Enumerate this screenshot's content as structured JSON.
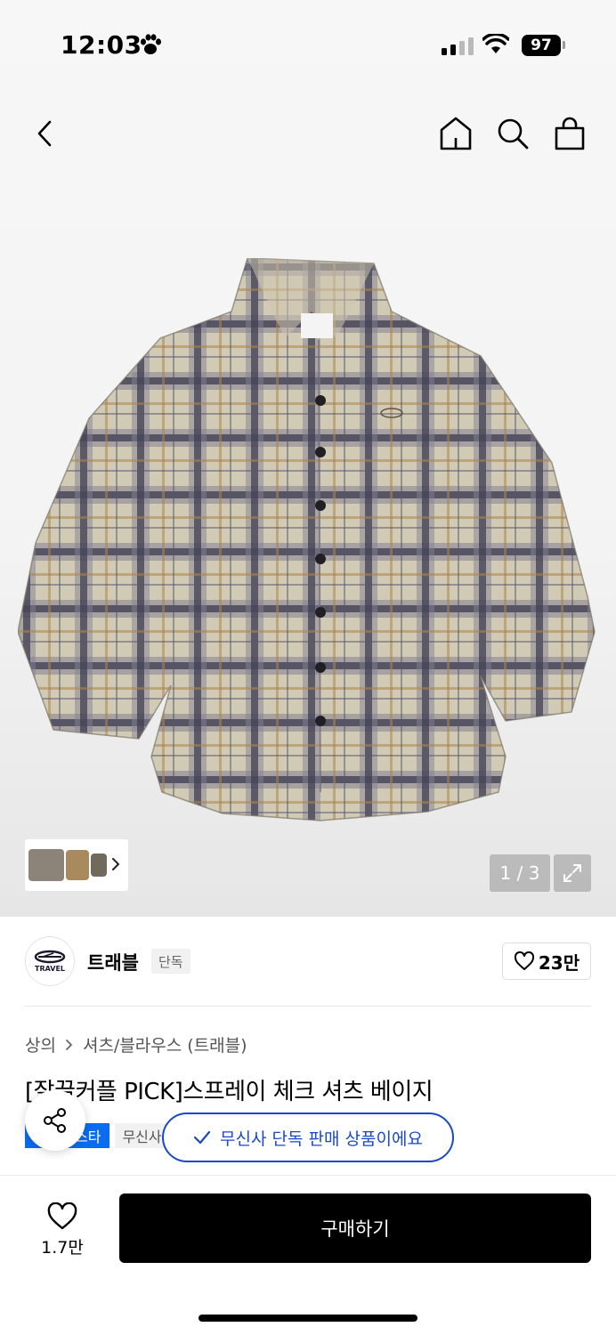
{
  "status_bar": {
    "time": "12:03",
    "battery": "97"
  },
  "gallery": {
    "counter": "1 / 3",
    "expand_icon": "expand-icon",
    "thumb_count": 3
  },
  "brand": {
    "name": "트래블",
    "tag": "단독",
    "likes": "23만"
  },
  "breadcrumb": {
    "category": "상의",
    "subcategory": "셔츠/블라우스 (트래블)"
  },
  "product": {
    "title": "[잘끌커플 PICK]스프레이 체크 셔츠 베이지"
  },
  "badges": {
    "blue": "스타",
    "gray": "무신사"
  },
  "toast": {
    "text": "무신사 단독 판매 상품이에요"
  },
  "bottom": {
    "like_count": "1.7만",
    "buy_label": "구매하기"
  },
  "colors": {
    "accent": "#1a48c8",
    "badge_blue": "#0a6cf0",
    "buy_bg": "#000000"
  }
}
